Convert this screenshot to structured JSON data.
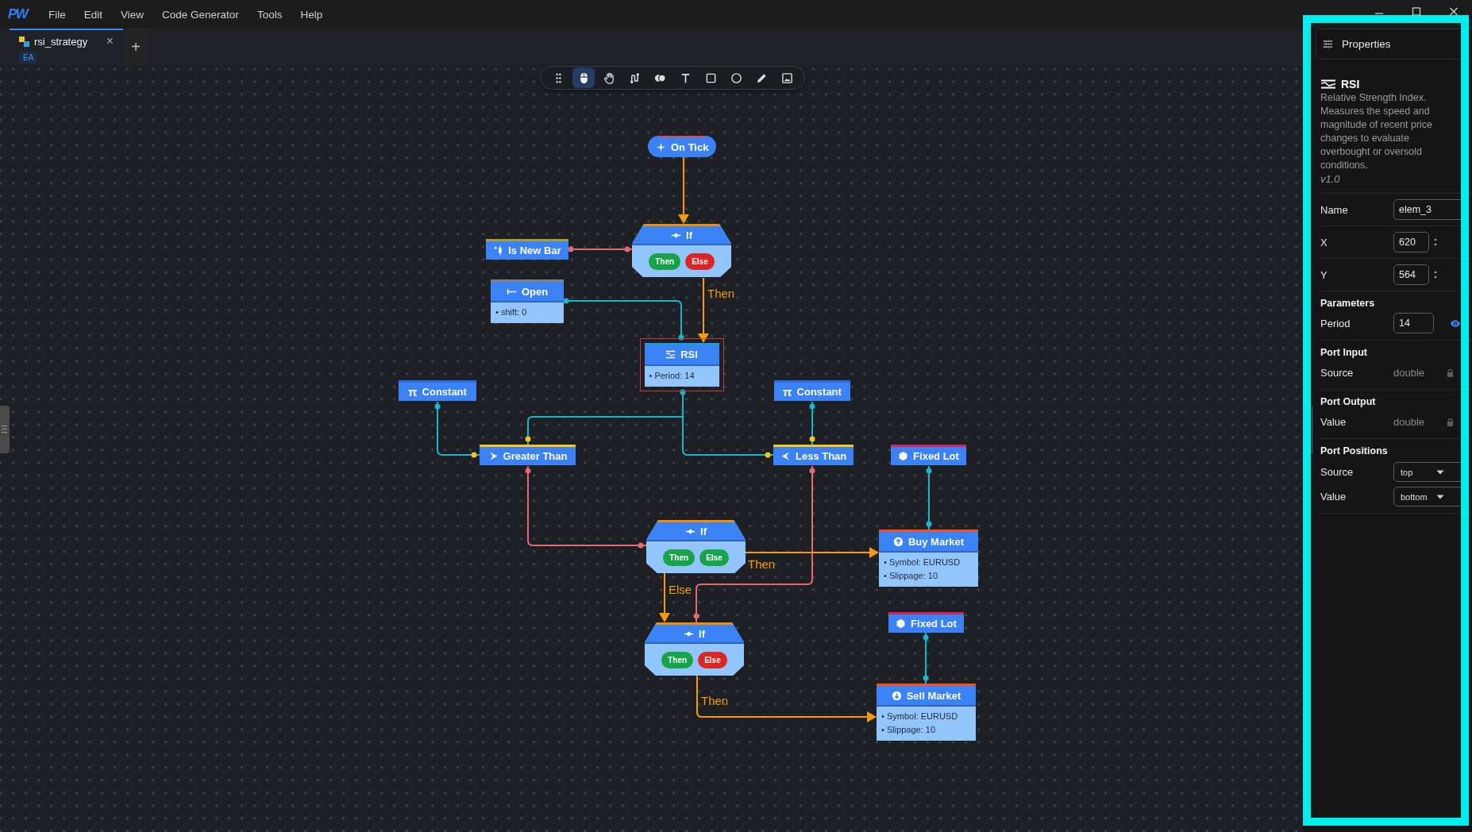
{
  "menu_bar": {
    "logo": "PW",
    "items": [
      "File",
      "Edit",
      "View",
      "Code Generator",
      "Tools",
      "Help"
    ]
  },
  "tabs": [
    {
      "label": "rsi_strategy",
      "badge": "EA",
      "close": "×",
      "selected": true
    }
  ],
  "new_tab_button": "+",
  "toolbar": [
    {
      "kind": "grip",
      "selected": false
    },
    {
      "kind": "pointer",
      "selected": true
    },
    {
      "kind": "hand",
      "selected": false
    },
    {
      "kind": "connector",
      "selected": false
    },
    {
      "kind": "blend",
      "selected": false
    },
    {
      "kind": "text",
      "selected": false
    },
    {
      "kind": "rectangle",
      "selected": false
    },
    {
      "kind": "ellipse",
      "selected": false
    },
    {
      "kind": "pencil",
      "selected": false
    },
    {
      "kind": "image",
      "selected": false
    }
  ],
  "canvas": {
    "nodes": [
      {
        "kind": "event",
        "title": "On Tick",
        "color": "#e0474c",
        "selected": false
      },
      {
        "kind": "signal",
        "title": "Is New Bar",
        "color": "#a89f2c",
        "selected": false
      },
      {
        "kind": "if",
        "title": "If",
        "color": "#f08c00",
        "selected": false,
        "branches": [
          {
            "label": "Then",
            "connected": true
          },
          {
            "label": "Else",
            "connected": false
          }
        ]
      },
      {
        "kind": "price",
        "title": "Open",
        "color": "#808080",
        "selected": false,
        "params": [
          "• shift: 0"
        ]
      },
      {
        "kind": "constant",
        "glyph": "π",
        "title": "Constant",
        "color": "#2a6fe0",
        "selected": false
      },
      {
        "kind": "indicator",
        "title": "RSI",
        "color": "#1c9ee6",
        "selected": true,
        "params": [
          "• Period: 14"
        ]
      },
      {
        "kind": "constant",
        "glyph": "π",
        "title": "Constant",
        "color": "#2a6fe0",
        "selected": false
      },
      {
        "kind": "greater",
        "title": "Greater Than",
        "color": "#f5c518",
        "selected": false
      },
      {
        "kind": "less",
        "title": "Less Than",
        "color": "#f5c518",
        "selected": false
      },
      {
        "kind": "lot",
        "title": "Fixed Lot",
        "color": "#d0245e",
        "selected": false
      },
      {
        "kind": "if",
        "title": "If",
        "color": "#f08c00",
        "selected": false,
        "branches": [
          {
            "label": "Then",
            "connected": true
          },
          {
            "label": "Else",
            "connected": true
          }
        ]
      },
      {
        "kind": "buy",
        "title": "Buy Market",
        "color": "#f05323",
        "selected": false,
        "params": [
          "• Symbol: EURUSD",
          "• Slippage: 10"
        ]
      },
      {
        "kind": "if",
        "title": "If",
        "color": "#f08c00",
        "selected": false,
        "branches": [
          {
            "label": "Then",
            "connected": true
          },
          {
            "label": "Else",
            "connected": false
          }
        ]
      },
      {
        "kind": "lot",
        "title": "Fixed Lot",
        "color": "#d0245e",
        "selected": false
      },
      {
        "kind": "sell",
        "title": "Sell Market",
        "color": "#f05323",
        "selected": false,
        "params": [
          "• Symbol: EURUSD",
          "• Slippage: 10"
        ]
      }
    ],
    "edges": [
      {
        "kind": "flow"
      },
      {
        "kind": "bool"
      },
      {
        "kind": "data"
      },
      {
        "kind": "flow",
        "label": "Then"
      },
      {
        "kind": "data"
      },
      {
        "kind": "data"
      },
      {
        "kind": "data"
      },
      {
        "kind": "data"
      },
      {
        "kind": "bool"
      },
      {
        "kind": "bool"
      },
      {
        "kind": "data"
      },
      {
        "kind": "flow",
        "label": "Then"
      },
      {
        "kind": "flow",
        "label": "Else"
      },
      {
        "kind": "data"
      },
      {
        "kind": "flow",
        "label": "Then"
      }
    ]
  },
  "properties_panel": {
    "title": "Properties",
    "node": {
      "title": "RSI",
      "description": "Relative Strength Index. Measures the speed and magnitude of recent price changes to evaluate overbought or oversold conditions.",
      "version": "v1.0"
    },
    "fields": [
      {
        "label": "Name",
        "kind": "text",
        "value": "elem_3"
      },
      {
        "label": "X",
        "kind": "number",
        "value": "620"
      },
      {
        "label": "Y",
        "kind": "number",
        "value": "564"
      }
    ],
    "sections": [
      {
        "title": "Parameters",
        "rows": [
          {
            "label": "Period",
            "kind": "param",
            "value": "14",
            "visible": true
          }
        ]
      },
      {
        "title": "Port Input",
        "rows": [
          {
            "label": "Source",
            "kind": "type",
            "value": "double",
            "locked": true
          }
        ]
      },
      {
        "title": "Port Output",
        "rows": [
          {
            "label": "Value",
            "kind": "type",
            "value": "double",
            "locked": true
          }
        ]
      },
      {
        "title": "Port Positions",
        "rows": [
          {
            "label": "Source",
            "kind": "select",
            "value": "top"
          },
          {
            "label": "Value",
            "kind": "select",
            "value": "bottom"
          }
        ]
      }
    ]
  }
}
